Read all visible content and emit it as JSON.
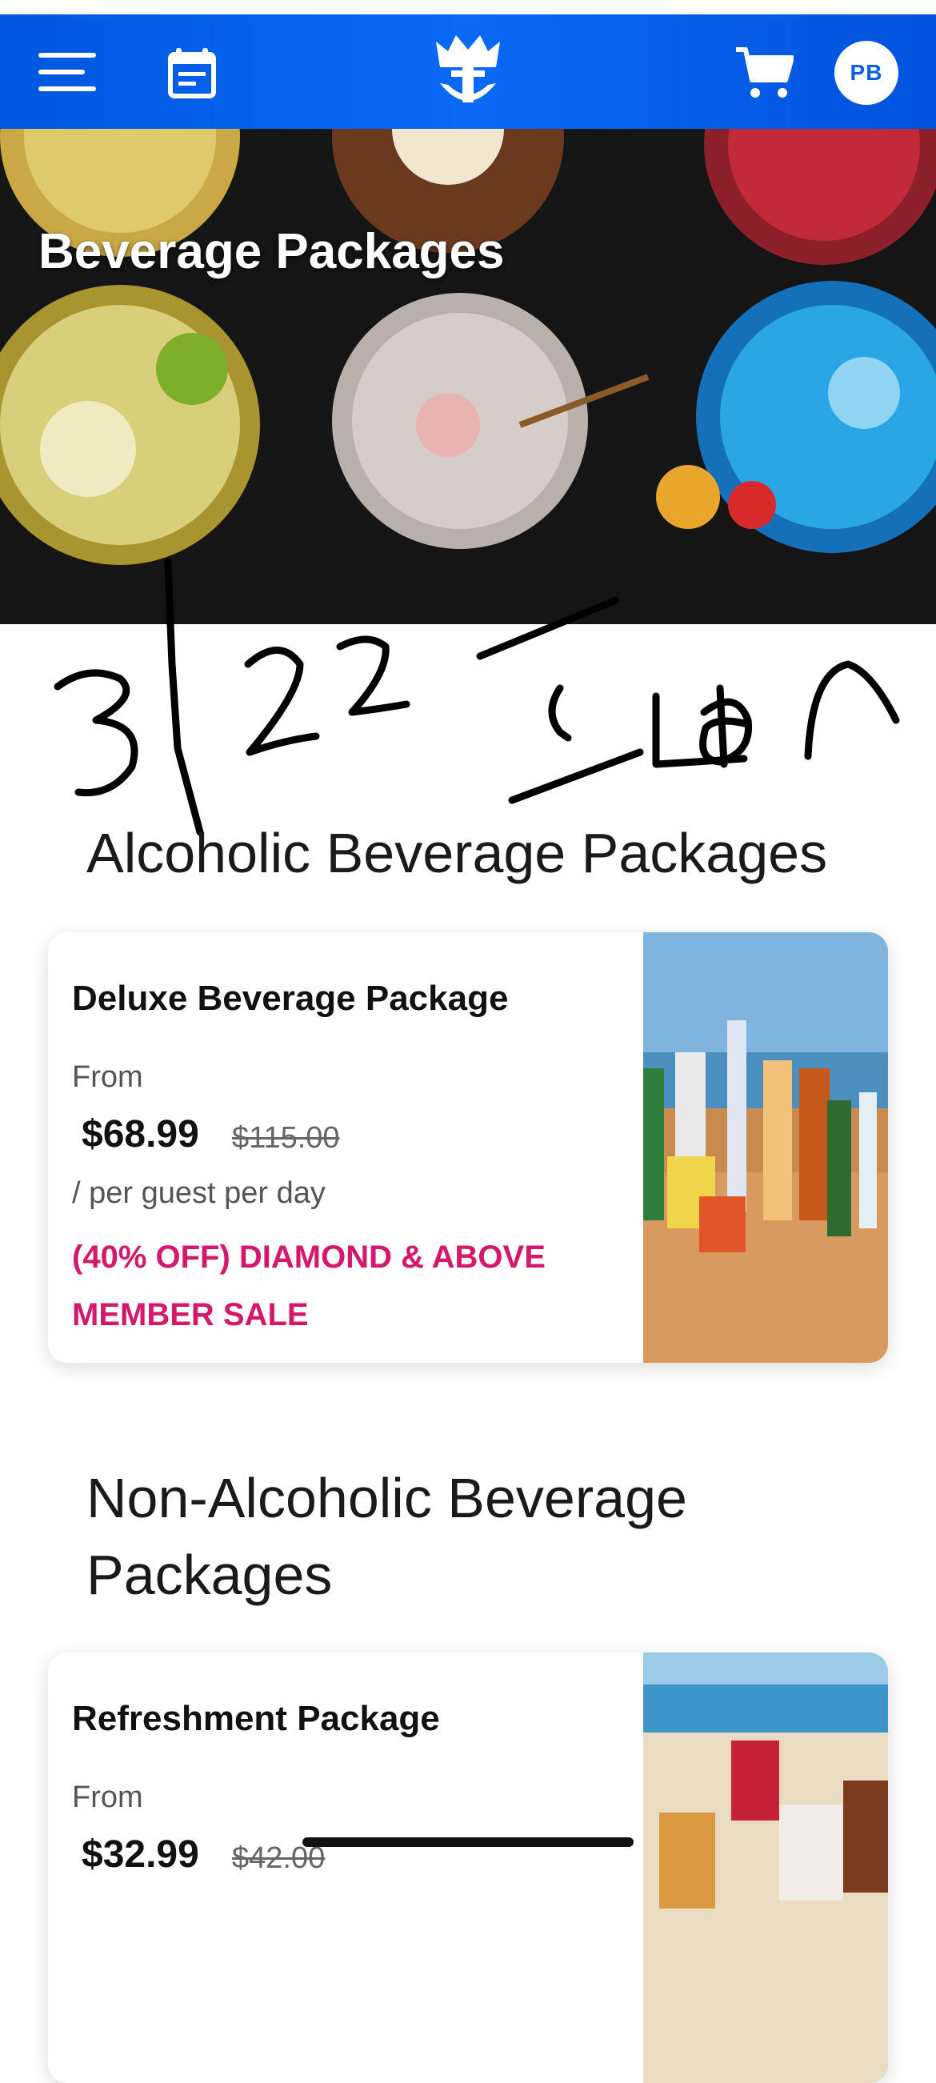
{
  "header": {
    "avatar_initials": "PB",
    "background_color": "#0a64f0",
    "icons": [
      "menu-icon",
      "calendar-icon",
      "royal-crown-anchor-logo",
      "cart-icon"
    ]
  },
  "hero": {
    "title": "Beverage Packages"
  },
  "handwritten_note": "3/22 Iron",
  "sections": [
    {
      "title": "Alcoholic Beverage Packages",
      "card": {
        "name": "Deluxe Beverage Package",
        "from_label": "From",
        "price": "$68.99",
        "original_price": "$115.00",
        "per_label": "/ per guest per day",
        "promo": "(40% OFF) DIAMOND & ABOVE MEMBER SALE"
      }
    },
    {
      "title": "Non-Alcoholic Beverage Packages",
      "card": {
        "name": "Refreshment Package",
        "from_label": "From",
        "price": "$32.99",
        "original_price": "$42.00"
      }
    }
  ],
  "colors": {
    "promo": "#d4186c",
    "brand_blue": "#0a64f0"
  }
}
